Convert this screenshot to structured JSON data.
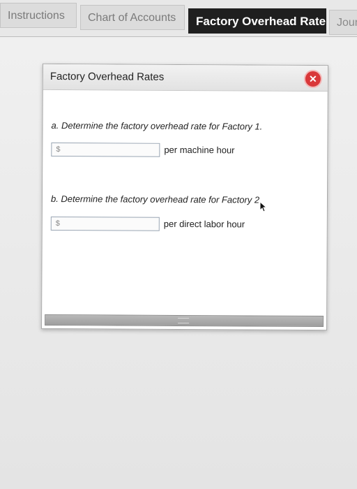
{
  "tabs": [
    {
      "label": "Instructions"
    },
    {
      "label": "Chart of Accounts"
    },
    {
      "label": "Factory Overhead Rates"
    },
    {
      "label": "Jour"
    }
  ],
  "dialog": {
    "title": "Factory Overhead Rates",
    "close_icon": "close-icon",
    "questions": [
      {
        "prompt": "a. Determine the factory overhead rate for Factory 1.",
        "currency_symbol": "$",
        "value": "",
        "unit": "per machine hour"
      },
      {
        "prompt": "b. Determine the factory overhead rate for Factory 2.",
        "currency_symbol": "$",
        "value": "",
        "unit": "per direct labor hour"
      }
    ]
  },
  "colors": {
    "active_tab": "#1f1f1f",
    "close_button": "#d9383a"
  }
}
